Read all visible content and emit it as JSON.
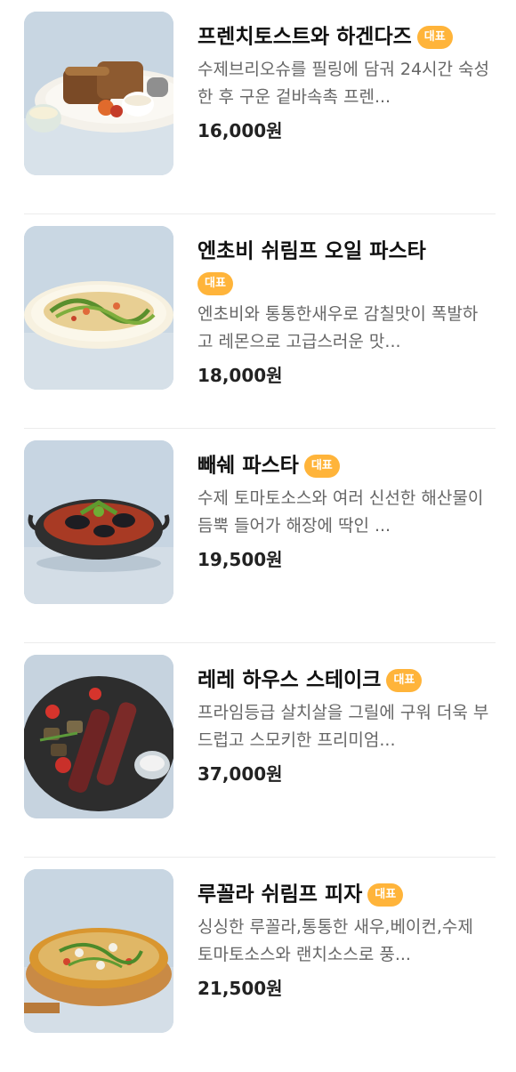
{
  "menu": {
    "badge_label": "대표",
    "items": [
      {
        "name": "프렌치토스트와 하겐다즈",
        "desc": "수제브리오슈를 필링에 담궈 24시간 숙성한 후 구운 겉바속촉 프렌...",
        "price": "16,000원",
        "icon": "french-toast-photo"
      },
      {
        "name": "엔초비 쉬림프 오일 파스타",
        "desc": "엔초비와 통통한새우로 감칠맛이 폭발하고 레몬으로 고급스러운 맛...",
        "price": "18,000원",
        "icon": "oil-pasta-photo"
      },
      {
        "name": "빼쉐 파스타",
        "desc": "수제 토마토소스와 여러 신선한 해산물이 듬뿍 들어가 해장에 딱인 ...",
        "price": "19,500원",
        "icon": "seafood-pasta-photo"
      },
      {
        "name": "레레 하우스 스테이크",
        "desc": "프라임등급 살치살을 그릴에 구워 더욱 부드럽고 스모키한 프리미엄...",
        "price": "37,000원",
        "icon": "steak-photo"
      },
      {
        "name": "루꼴라 쉬림프 피자",
        "desc": "싱싱한 루꼴라,통통한 새우,베이컨,수제 토마토소스와 랜치소스로 풍...",
        "price": "21,500원",
        "icon": "pizza-photo"
      }
    ]
  }
}
